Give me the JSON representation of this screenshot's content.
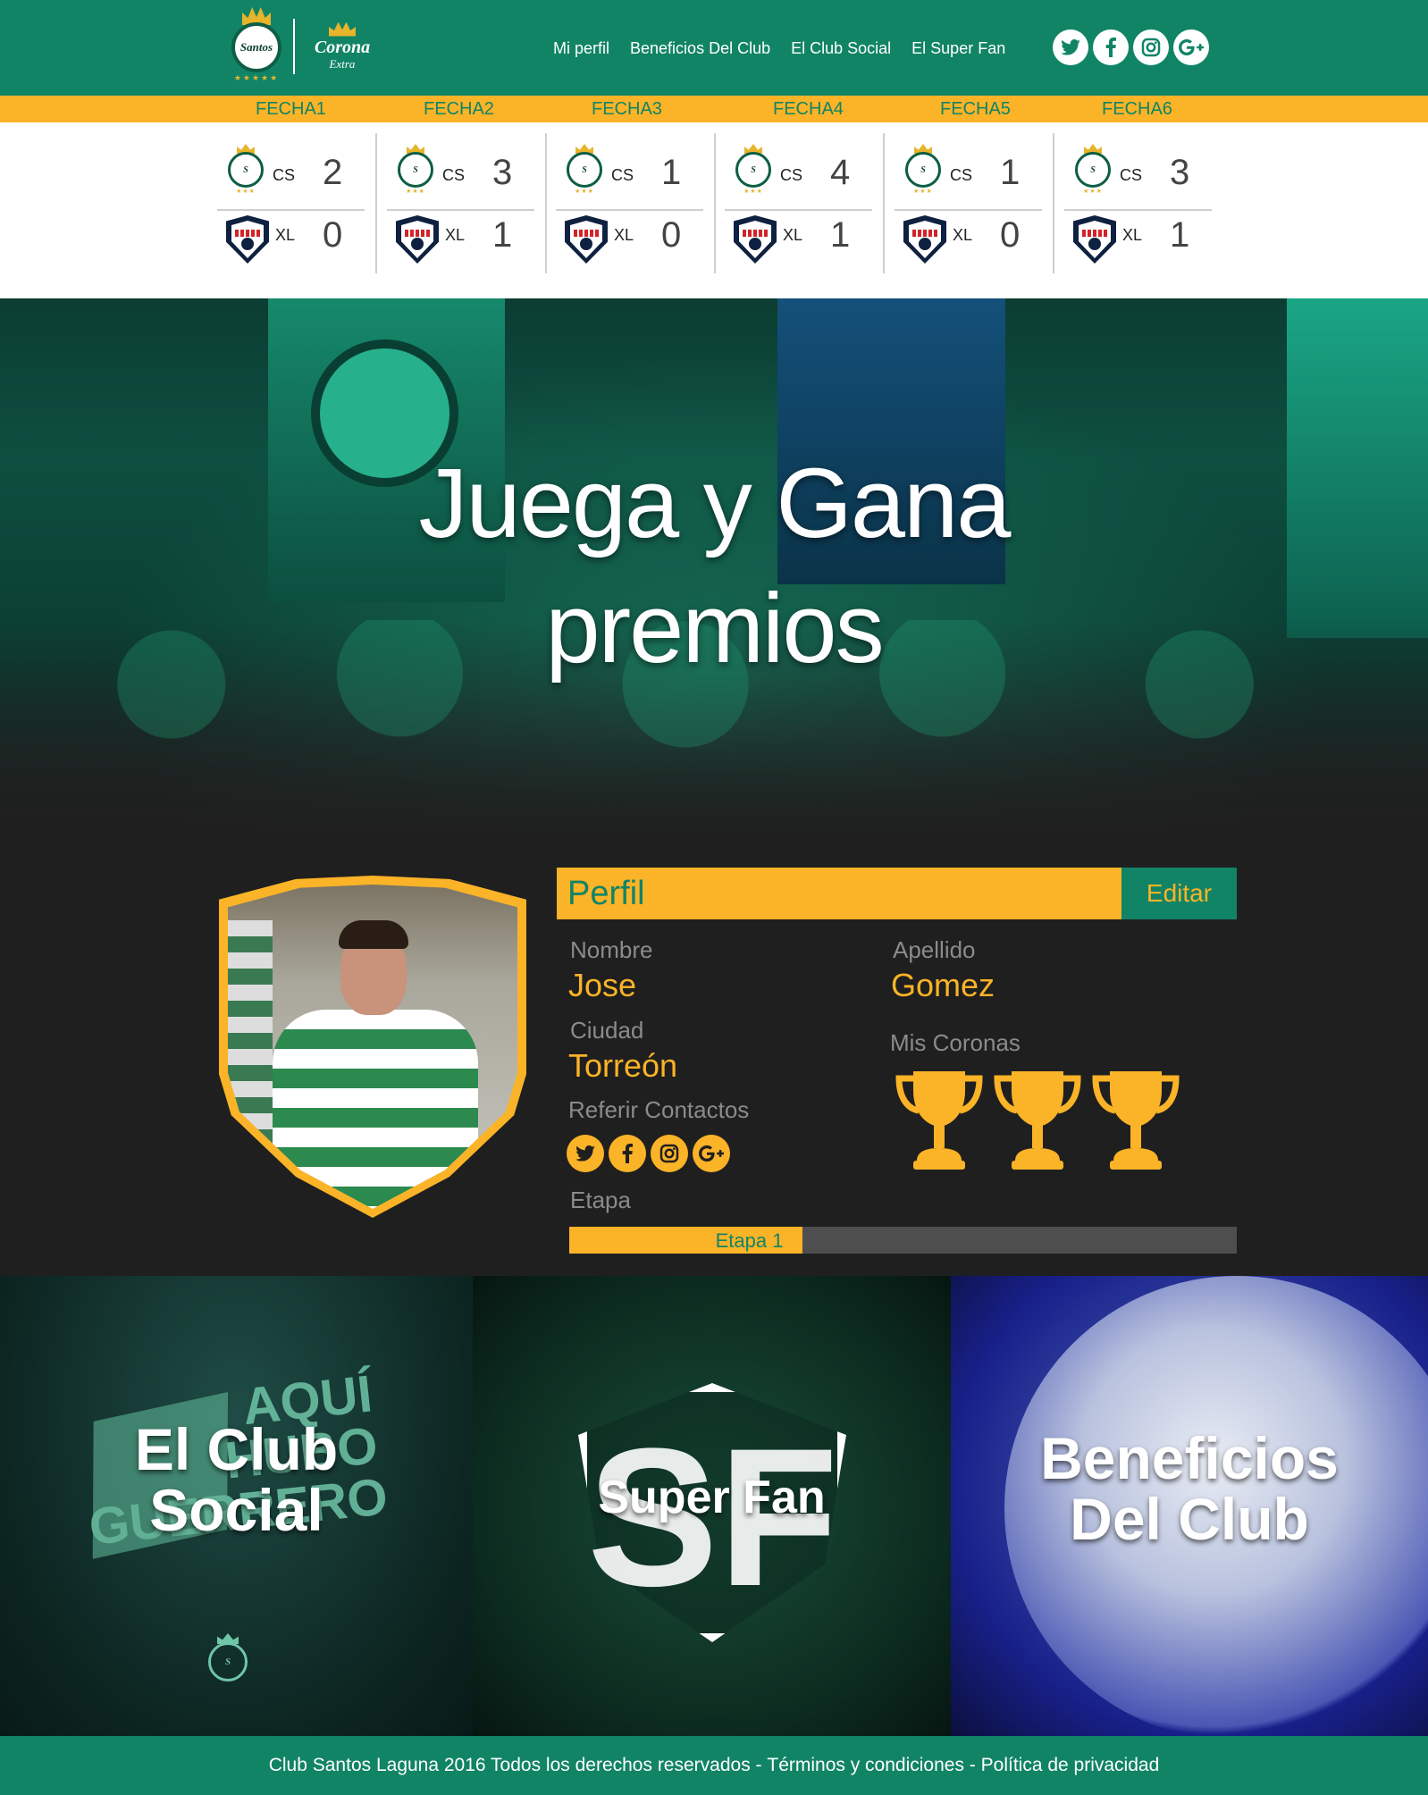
{
  "header": {
    "club_logo_text": "Santos",
    "sponsor_name": "Corona",
    "sponsor_sub": "Extra",
    "nav": [
      "Mi perfil",
      "Beneficios Del Club",
      "El Club Social",
      "El Super Fan"
    ],
    "social": [
      "twitter-icon",
      "facebook-icon",
      "instagram-icon",
      "google-plus-icon"
    ]
  },
  "fechas": [
    "FECHA1",
    "FECHA2",
    "FECHA3",
    "FECHA4",
    "FECHA5",
    "FECHA6"
  ],
  "matches": [
    {
      "home": "CS",
      "home_score": "2",
      "away": "XL",
      "away_score": "0"
    },
    {
      "home": "CS",
      "home_score": "3",
      "away": "XL",
      "away_score": "1"
    },
    {
      "home": "CS",
      "home_score": "1",
      "away": "XL",
      "away_score": "0"
    },
    {
      "home": "CS",
      "home_score": "4",
      "away": "XL",
      "away_score": "1"
    },
    {
      "home": "CS",
      "home_score": "1",
      "away": "XL",
      "away_score": "0"
    },
    {
      "home": "CS",
      "home_score": "3",
      "away": "XL",
      "away_score": "1"
    }
  ],
  "hero": {
    "line1": "Juega y Gana",
    "line2": "premios"
  },
  "profile": {
    "title": "Perfil",
    "edit_label": "Editar",
    "nombre_label": "Nombre",
    "nombre": "Jose",
    "apellido_label": "Apellido",
    "apellido": "Gomez",
    "ciudad_label": "Ciudad",
    "ciudad": "Torreón",
    "coronas_label": "Mis Coronas",
    "coronas_count": 3,
    "referir_label": "Referir Contactos",
    "etapa_label": "Etapa",
    "etapa_value": "Etapa 1",
    "etapa_progress": 0.35
  },
  "tiles": {
    "club_social": {
      "line1": "El Club",
      "line2": "Social",
      "bg_text": "AQUÍ HUBO GUERRERO"
    },
    "super_fan": {
      "label": "Super Fan",
      "bg_letters": "SF"
    },
    "beneficios": {
      "line1": "Beneficios",
      "line2": "Del Club"
    }
  },
  "footer": {
    "copyright": "Club Santos Laguna 2016 Todos los derechos reservados",
    "terms": "Términos y condiciones",
    "privacy": "Política de privacidad",
    "sep": " - "
  },
  "colors": {
    "green": "#118466",
    "yellow": "#fbb327",
    "dark": "#1f1f1f"
  }
}
